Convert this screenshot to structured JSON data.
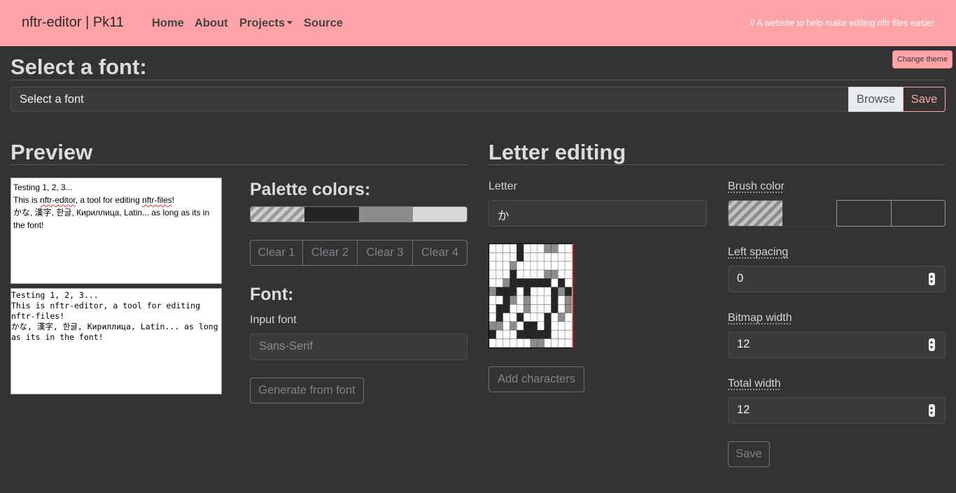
{
  "navbar": {
    "brand": "nftr-editor | Pk11",
    "links": [
      "Home",
      "About",
      "Projects",
      "Source"
    ],
    "tagline": "// A website to help make editing nftr files easier",
    "color": "#ffa3a8"
  },
  "theme_button": "Change theme",
  "select_font": {
    "heading": "Select a font:",
    "placeholder": "Select a font",
    "browse_label": "Browse",
    "save_label": "Save"
  },
  "preview": {
    "heading": "Preview",
    "box1_lines": [
      "Testing 1, 2, 3...",
      "This is nftr-editor, a tool for editing nftr-files!",
      "",
      "かな, 漢字, 한글, Кириллица, Latin... as long as its in the font!"
    ],
    "box2_lines": [
      "Testing 1, 2, 3...",
      "This is nftr-editor, a tool for editing nftr-files!",
      "",
      "かな, 漢字, 한글, Кириллица, Latin... as long as its in the font!"
    ]
  },
  "palette": {
    "heading": "Palette colors:",
    "colors": [
      "transparent",
      "#252525",
      "#8c8c8c",
      "#d8d8d8"
    ],
    "clear_buttons": [
      "Clear 1",
      "Clear 2",
      "Clear 3",
      "Clear 4"
    ]
  },
  "font_gen": {
    "heading": "Font:",
    "input_label": "Input font",
    "input_placeholder": "Sans-Serif",
    "generate_label": "Generate from font"
  },
  "letter_editing": {
    "heading": "Letter editing",
    "letter_label": "Letter",
    "letter_value": "か",
    "add_characters_label": "Add characters",
    "bitmap_rows": [
      "....3...22..",
      "....3.......",
      "...2........",
      "...3....22..",
      "..2333333.3.",
      "2333.3...323",
      "..32.2...3.2",
      ".33..2...3.2",
      ".3..3...3.2.",
      "22.2.33.3...",
      "3...33333...",
      "......22...."
    ],
    "brush_label": "Brush color",
    "brush_colors": [
      "transparent",
      "#333333",
      "#333333",
      "#333333"
    ],
    "left_spacing_label": "Left spacing",
    "left_spacing_value": "0",
    "bitmap_width_label": "Bitmap width",
    "bitmap_width_value": "12",
    "total_width_label": "Total width",
    "total_width_value": "12",
    "save_label": "Save"
  }
}
